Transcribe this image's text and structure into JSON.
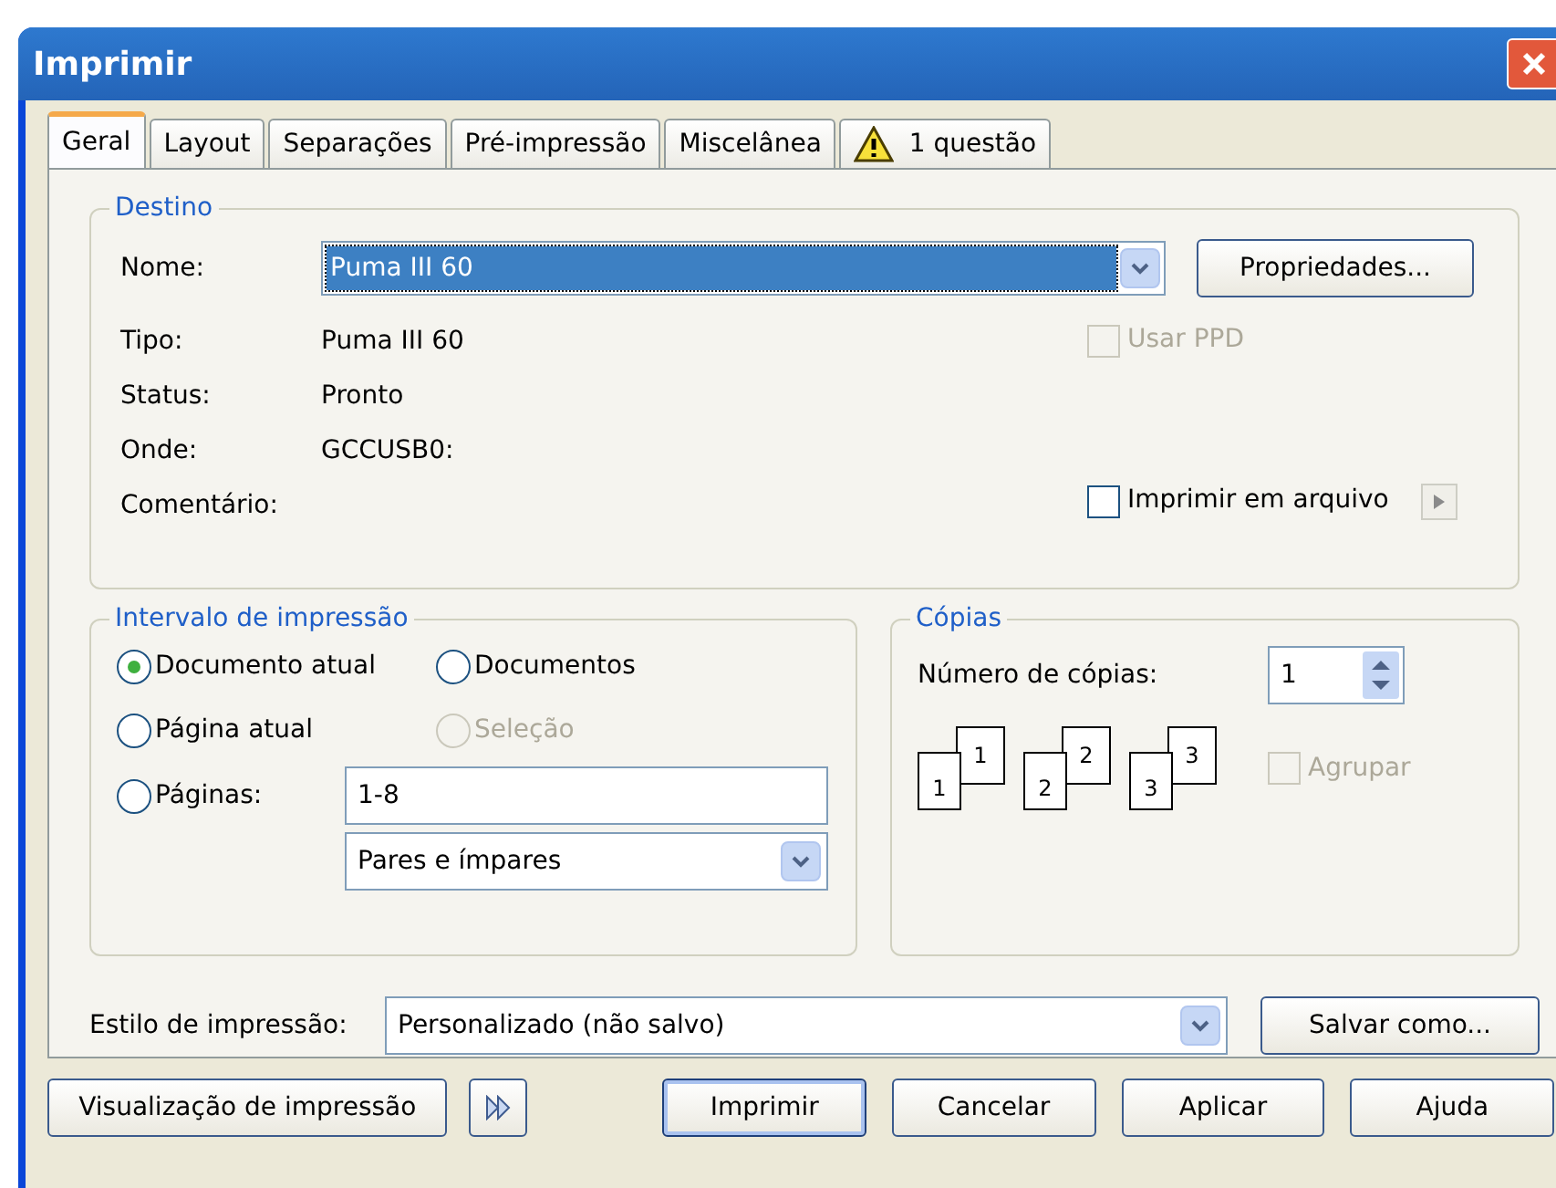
{
  "window": {
    "title": "Imprimir"
  },
  "tabs": [
    {
      "label": "Geral",
      "selected": true,
      "warning": false
    },
    {
      "label": "Layout",
      "selected": false,
      "warning": false
    },
    {
      "label": "Separações",
      "selected": false,
      "warning": false
    },
    {
      "label": "Pré-impressão",
      "selected": false,
      "warning": false
    },
    {
      "label": "Miscelânea",
      "selected": false,
      "warning": false
    },
    {
      "label": "1 questão",
      "selected": false,
      "warning": true
    }
  ],
  "destino": {
    "title": "Destino",
    "name_label": "Nome:",
    "name_value": "Puma III 60",
    "properties_button": "Propriedades...",
    "info": [
      {
        "label": "Tipo:",
        "value": "Puma III 60"
      },
      {
        "label": "Status:",
        "value": "Pronto"
      },
      {
        "label": "Onde:",
        "value": "GCCUSB0:"
      },
      {
        "label": "Comentário:"
      }
    ],
    "use_ppd": {
      "label": "Usar PPD",
      "checked": false,
      "disabled": true
    },
    "print_to_file": {
      "label": "Imprimir em arquivo",
      "checked": false,
      "disabled": false
    }
  },
  "intervalo": {
    "title": "Intervalo de impressão",
    "options": [
      {
        "label": "Documento atual",
        "selected": true,
        "disabled": false
      },
      {
        "label": "Documentos",
        "selected": false,
        "disabled": false
      },
      {
        "label": "Página atual",
        "selected": false,
        "disabled": false
      },
      {
        "label": "Seleção",
        "selected": false,
        "disabled": true
      },
      {
        "label": "Páginas:",
        "selected": false,
        "disabled": false
      }
    ],
    "pages_value": "1-8",
    "subset_value": "Pares e ímpares"
  },
  "copias": {
    "title": "Cópias",
    "count_label": "Número de cópias:",
    "count_value": "1",
    "collate_icons": [
      {
        "back": "1",
        "front": "1"
      },
      {
        "back": "2",
        "front": "2"
      },
      {
        "back": "3",
        "front": "3"
      }
    ],
    "collate": {
      "label": "Agrupar",
      "checked": false,
      "disabled": true
    }
  },
  "style": {
    "label": "Estilo de impressão:",
    "value": "Personalizado (não salvo)",
    "save_button": "Salvar como..."
  },
  "buttons": [
    {
      "label": "Visualização de impressão",
      "kind": "text",
      "default": false
    },
    {
      "kind": "more"
    },
    {
      "label": "Imprimir",
      "kind": "text",
      "default": true
    },
    {
      "label": "Cancelar",
      "kind": "text",
      "default": false
    },
    {
      "label": "Aplicar",
      "kind": "text",
      "default": false
    },
    {
      "label": "Ajuda",
      "kind": "text",
      "default": false
    }
  ]
}
